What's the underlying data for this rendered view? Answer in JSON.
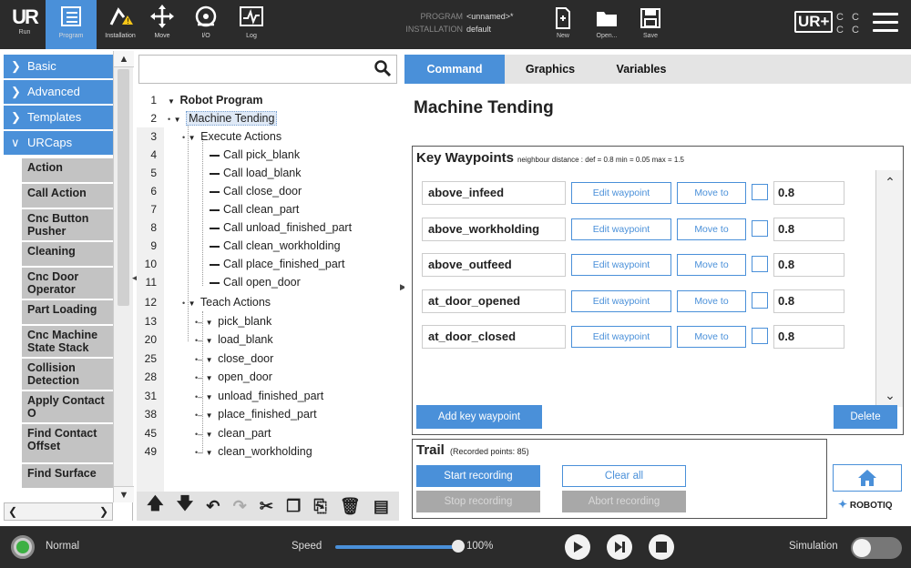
{
  "header": {
    "logo": "UR",
    "nav": [
      {
        "label": "Run",
        "icon": "ur-run-icon"
      },
      {
        "label": "Program",
        "icon": "program-icon"
      },
      {
        "label": "Installation",
        "icon": "installation-icon"
      },
      {
        "label": "Move",
        "icon": "move-icon"
      },
      {
        "label": "I/O",
        "icon": "io-icon"
      },
      {
        "label": "Log",
        "icon": "log-icon"
      }
    ],
    "program_key": "PROGRAM",
    "program_value": "<unnamed>*",
    "installation_key": "INSTALLATION",
    "installation_value": "default",
    "file_buttons": [
      {
        "label": "New",
        "icon": "new-file-icon"
      },
      {
        "label": "Open...",
        "icon": "folder-icon"
      },
      {
        "label": "Save",
        "icon": "save-icon"
      }
    ],
    "urplus_label": "UR+",
    "cc_label": "C C C C"
  },
  "sidebar": {
    "categories": [
      {
        "label": "Basic",
        "chevron": "chevron-right"
      },
      {
        "label": "Advanced",
        "chevron": "chevron-right"
      },
      {
        "label": "Templates",
        "chevron": "chevron-right"
      },
      {
        "label": "URCaps",
        "chevron": "chevron-down"
      }
    ],
    "items": [
      "Action",
      "Call Action",
      "Cnc Button Pusher",
      "Cleaning",
      "Cnc Door Operator",
      "Part Loading",
      "Cnc Machine State Stack",
      "Collision Detection",
      "Apply Contact O",
      "Find Contact Offset",
      "Find Surface"
    ]
  },
  "search": {
    "placeholder": ""
  },
  "tree": {
    "rows": [
      {
        "line": "1",
        "text": "Robot Program"
      },
      {
        "line": "2",
        "text": "Machine Tending"
      },
      {
        "line": "3",
        "text": "Execute Actions"
      },
      {
        "line": "4",
        "text": "Call pick_blank"
      },
      {
        "line": "5",
        "text": "Call load_blank"
      },
      {
        "line": "6",
        "text": "Call close_door"
      },
      {
        "line": "7",
        "text": "Call clean_part"
      },
      {
        "line": "8",
        "text": "Call unload_finished_part"
      },
      {
        "line": "9",
        "text": "Call clean_workholding"
      },
      {
        "line": "10",
        "text": "Call place_finished_part"
      },
      {
        "line": "11",
        "text": "Call open_door"
      },
      {
        "line": "12",
        "text": "Teach Actions"
      },
      {
        "line": "13",
        "text": "pick_blank"
      },
      {
        "line": "20",
        "text": "load_blank"
      },
      {
        "line": "25",
        "text": "close_door"
      },
      {
        "line": "28",
        "text": "open_door"
      },
      {
        "line": "31",
        "text": "unload_finished_part"
      },
      {
        "line": "38",
        "text": "place_finished_part"
      },
      {
        "line": "45",
        "text": "clean_part"
      },
      {
        "line": "49",
        "text": "clean_workholding"
      }
    ]
  },
  "tabs": [
    "Command",
    "Graphics",
    "Variables"
  ],
  "page_title": "Machine Tending",
  "key_waypoints": {
    "title": "Key Waypoints",
    "subtitle": "neighbour distance : def = 0.8 min = 0.05 max = 1.5",
    "edit_label": "Edit waypoint",
    "move_label": "Move to",
    "waypoints": [
      {
        "name": "above_infeed",
        "value": "0.8"
      },
      {
        "name": "above_workholding",
        "value": "0.8"
      },
      {
        "name": "above_outfeed",
        "value": "0.8"
      },
      {
        "name": "at_door_opened",
        "value": "0.8"
      },
      {
        "name": "at_door_closed",
        "value": "0.8"
      }
    ],
    "add_label": "Add key waypoint",
    "delete_label": "Delete"
  },
  "trail": {
    "title": "Trail",
    "subtitle": "(Recorded points: 85)",
    "start_label": "Start recording",
    "clear_label": "Clear all",
    "stop_label": "Stop recording",
    "abort_label": "Abort recording"
  },
  "brand": "ROBOTIQ",
  "footer": {
    "status": "Normal",
    "speed_label": "Speed",
    "speed_value": "100%",
    "speed_fraction": 1.0,
    "simulation_label": "Simulation",
    "simulation_on": false
  },
  "colors": {
    "accent": "#4a90d9",
    "header_bg": "#2b2b2b",
    "status_ok": "#3cb043"
  }
}
